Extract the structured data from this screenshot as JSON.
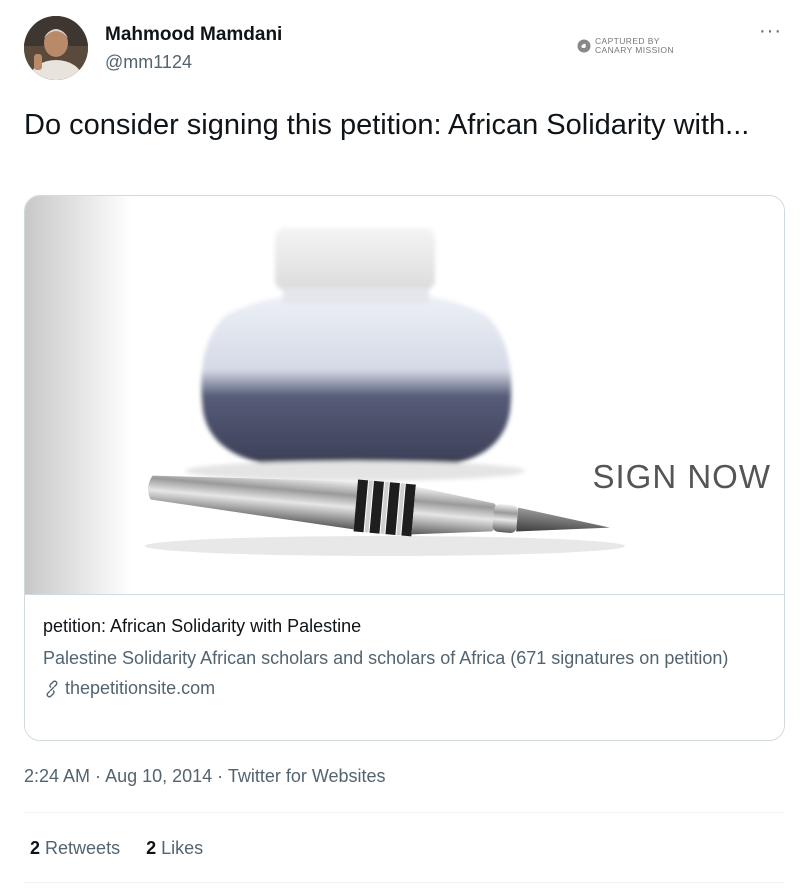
{
  "author": {
    "name": "Mahmood Mamdani",
    "handle": "@mm1124"
  },
  "watermark": {
    "text": "CAPTURED BY\nCANARY MISSION"
  },
  "more_label": "···",
  "tweet": {
    "text": "Do consider signing this petition: African Solidarity with..."
  },
  "card": {
    "image_overlay_text": "SIGN NOW",
    "title": "petition: African Solidarity with Palestine",
    "description": "Palestine Solidarity African scholars and scholars of Africa (671 signatures on petition)",
    "domain": "thepetitionsite.com"
  },
  "meta": {
    "time": "2:24 AM",
    "separator1": " · ",
    "date": "Aug 10, 2014",
    "separator2": " · ",
    "source": "Twitter for Websites"
  },
  "stats": {
    "retweets_count": "2",
    "retweets_label": "Retweets",
    "likes_count": "2",
    "likes_label": "Likes"
  },
  "icons": {
    "more": "more-horizontal-icon",
    "link": "link-icon",
    "watermark": "canary-mission-icon"
  }
}
